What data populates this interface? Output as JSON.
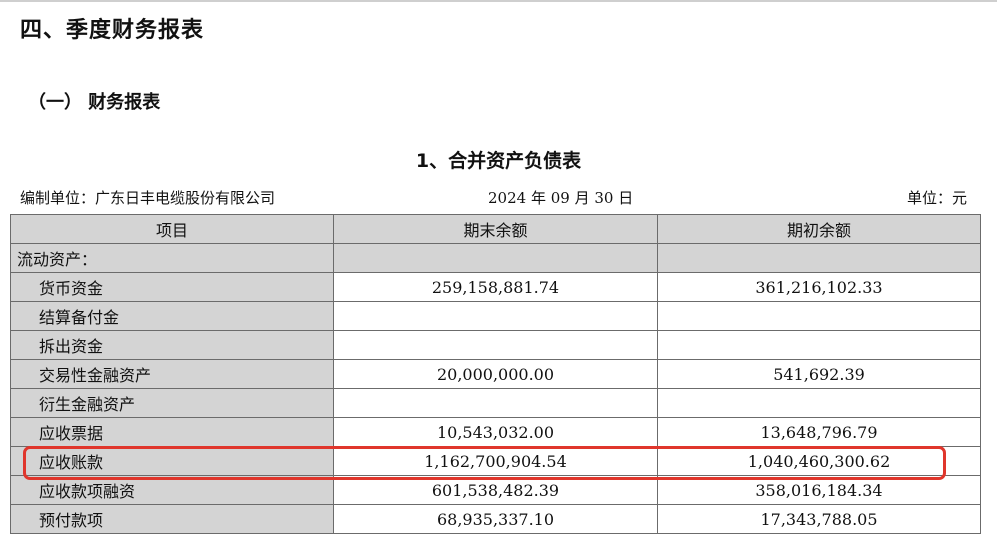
{
  "section_title": "四、季度财务报表",
  "subsection_title": "（一） 财务报表",
  "table_title": "1、合并资产负债表",
  "meta": {
    "company": "编制单位：广东日丰电缆股份有限公司",
    "date": "2024 年 09 月 30 日",
    "unit": "单位：元"
  },
  "columns": [
    "项目",
    "期末余额",
    "期初余额"
  ],
  "rows": [
    {
      "item": "流动资产：",
      "end": "",
      "begin": ""
    },
    {
      "item": "货币资金",
      "end": "259,158,881.74",
      "begin": "361,216,102.33"
    },
    {
      "item": "结算备付金",
      "end": "",
      "begin": ""
    },
    {
      "item": "拆出资金",
      "end": "",
      "begin": ""
    },
    {
      "item": "交易性金融资产",
      "end": "20,000,000.00",
      "begin": "541,692.39"
    },
    {
      "item": "衍生金融资产",
      "end": "",
      "begin": ""
    },
    {
      "item": "应收票据",
      "end": "10,543,032.00",
      "begin": "13,648,796.79"
    },
    {
      "item": "应收账款",
      "end": "1,162,700,904.54",
      "begin": "1,040,460,300.62"
    },
    {
      "item": "应收款项融资",
      "end": "601,538,482.39",
      "begin": "358,016,184.34"
    },
    {
      "item": "预付款项",
      "end": "68,935,337.10",
      "begin": "17,343,788.05"
    }
  ],
  "colors": {
    "highlight": "#e0362c",
    "header_bg": "#d4d4d4"
  }
}
